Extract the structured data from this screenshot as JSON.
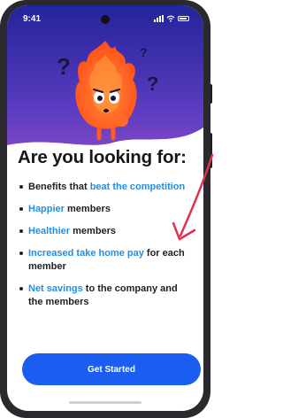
{
  "status_bar": {
    "time": "9:41",
    "icons": [
      "signal-icon",
      "wifi-icon",
      "battery-icon"
    ]
  },
  "hero": {
    "illustration": "flame-mascot-character",
    "decorations": [
      "question-mark-icon",
      "question-mark-icon",
      "question-mark-icon"
    ]
  },
  "heading": "Are you looking for:",
  "benefits": [
    {
      "segments": [
        {
          "text": "Benefits that ",
          "highlight": false
        },
        {
          "text": "beat the competition",
          "highlight": true
        }
      ]
    },
    {
      "segments": [
        {
          "text": "Happier",
          "highlight": true
        },
        {
          "text": " members",
          "highlight": false
        }
      ]
    },
    {
      "segments": [
        {
          "text": "Healthier",
          "highlight": true
        },
        {
          "text": " members",
          "highlight": false
        }
      ]
    },
    {
      "segments": [
        {
          "text": "Increased take home pay",
          "highlight": true
        },
        {
          "text": " for each member",
          "highlight": false
        }
      ]
    },
    {
      "segments": [
        {
          "text": "Net savings",
          "highlight": true
        },
        {
          "text": " to the company and the members",
          "highlight": false
        }
      ]
    }
  ],
  "cta": {
    "label": "Get Started"
  },
  "annotation": {
    "icon": "red-arrow-icon"
  },
  "colors": {
    "highlight": "#1f8fe6",
    "button": "#1b5df0",
    "hero_top": "#2a2fa0",
    "hero_bottom": "#6b3fb8",
    "text": "#16161d",
    "arrow": "#e0314f"
  }
}
